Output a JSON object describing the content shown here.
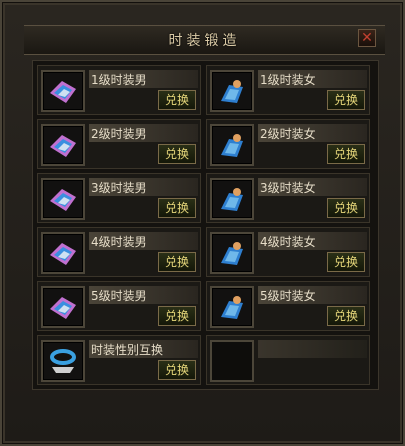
{
  "window": {
    "title": "时装锻造",
    "close_icon": "close-icon"
  },
  "button_label": "兑换",
  "items": [
    {
      "name": "1级时装男",
      "icon": "male-fashion-icon"
    },
    {
      "name": "1级时装女",
      "icon": "female-fashion-icon"
    },
    {
      "name": "2级时装男",
      "icon": "male-fashion-icon"
    },
    {
      "name": "2级时装女",
      "icon": "female-fashion-icon"
    },
    {
      "name": "3级时装男",
      "icon": "male-fashion-icon"
    },
    {
      "name": "3级时装女",
      "icon": "female-fashion-icon"
    },
    {
      "name": "4级时装男",
      "icon": "male-fashion-icon"
    },
    {
      "name": "4级时装女",
      "icon": "female-fashion-icon"
    },
    {
      "name": "5级时装男",
      "icon": "male-fashion-icon"
    },
    {
      "name": "5级时装女",
      "icon": "female-fashion-icon"
    },
    {
      "name": "时装性别互换",
      "icon": "gender-swap-icon"
    }
  ],
  "empty_slot": true,
  "colors": {
    "accent_button_text": "#e6d77a",
    "label_text": "#e6ddc8",
    "title_text": "#d9c9a5"
  }
}
